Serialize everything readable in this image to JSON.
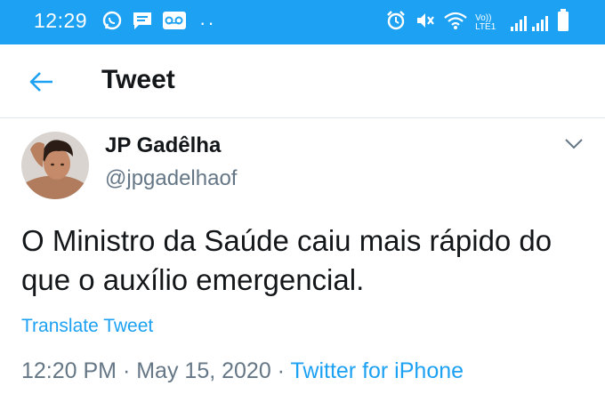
{
  "status_bar": {
    "time": "12:29",
    "network_label": "Vo)) LTE1",
    "left_icons": [
      "whatsapp-icon",
      "message-icon",
      "voicemail-icon",
      "more-dots-icon"
    ],
    "right_icons": [
      "alarm-icon",
      "mute-icon",
      "wifi-icon",
      "signal-icon",
      "battery-icon"
    ],
    "bar_color": "#1da1f2"
  },
  "header": {
    "title": "Tweet",
    "back_icon": "back-arrow-icon"
  },
  "tweet": {
    "author_name": "JP Gadêlha",
    "author_handle": "@jpgadelhaof",
    "text": "O Ministro da Saúde caiu mais rápido do que o auxílio emergencial.",
    "translate_label": "Translate Tweet",
    "time": "12:20 PM",
    "date": "May 15, 2020",
    "source": "Twitter for iPhone",
    "separator": " · ",
    "menu_icon": "chevron-down-icon"
  },
  "colors": {
    "accent": "#1da1f2",
    "text_primary": "#14171a",
    "text_secondary": "#657786"
  }
}
